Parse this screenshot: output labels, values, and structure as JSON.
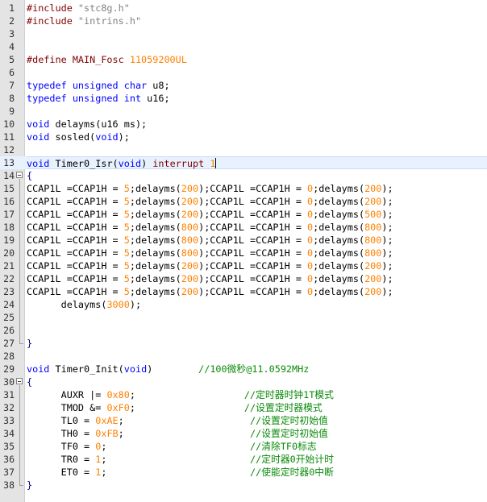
{
  "editor": {
    "current_line": 13,
    "lines": [
      {
        "n": "1",
        "toks": [
          [
            "pp",
            "#include "
          ],
          [
            "str",
            "\"stc8g.h\""
          ]
        ]
      },
      {
        "n": "2",
        "toks": [
          [
            "pp",
            "#include "
          ],
          [
            "str",
            "\"intrins.h\""
          ]
        ]
      },
      {
        "n": "3",
        "toks": []
      },
      {
        "n": "4",
        "toks": []
      },
      {
        "n": "5",
        "toks": [
          [
            "pp",
            "#define MAIN_Fosc "
          ],
          [
            "num",
            "11059200UL"
          ]
        ]
      },
      {
        "n": "6",
        "toks": []
      },
      {
        "n": "7",
        "toks": [
          [
            "kw",
            "typedef unsigned char"
          ],
          [
            "tx",
            " u8;"
          ]
        ]
      },
      {
        "n": "8",
        "toks": [
          [
            "kw",
            "typedef unsigned int"
          ],
          [
            "tx",
            " u16;"
          ]
        ]
      },
      {
        "n": "9",
        "toks": []
      },
      {
        "n": "10",
        "toks": [
          [
            "kw",
            "void"
          ],
          [
            "tx",
            " delayms(u16 ms);"
          ]
        ]
      },
      {
        "n": "11",
        "toks": [
          [
            "kw",
            "void"
          ],
          [
            "tx",
            " sosled("
          ],
          [
            "kw",
            "void"
          ],
          [
            "tx",
            ");"
          ]
        ]
      },
      {
        "n": "12",
        "toks": []
      },
      {
        "n": "13",
        "toks": [
          [
            "kw",
            "void"
          ],
          [
            "tx",
            " Timer0_Isr("
          ],
          [
            "kw",
            "void"
          ],
          [
            "tx",
            ") "
          ],
          [
            "pp",
            "interrupt"
          ],
          [
            "tx",
            " "
          ],
          [
            "num",
            "1"
          ]
        ]
      },
      {
        "n": "14",
        "toks": [
          [
            "op",
            "{"
          ]
        ],
        "fold": "start"
      },
      {
        "n": "15",
        "toks": [
          [
            "tx",
            "CCAP1L =CCAP1H = "
          ],
          [
            "num",
            "5"
          ],
          [
            "tx",
            ";delayms("
          ],
          [
            "num",
            "200"
          ],
          [
            "tx",
            ");CCAP1L =CCAP1H = "
          ],
          [
            "num",
            "0"
          ],
          [
            "tx",
            ";delayms("
          ],
          [
            "num",
            "200"
          ],
          [
            "tx",
            ");"
          ]
        ]
      },
      {
        "n": "16",
        "toks": [
          [
            "tx",
            "CCAP1L =CCAP1H = "
          ],
          [
            "num",
            "5"
          ],
          [
            "tx",
            ";delayms("
          ],
          [
            "num",
            "200"
          ],
          [
            "tx",
            ");CCAP1L =CCAP1H = "
          ],
          [
            "num",
            "0"
          ],
          [
            "tx",
            ";delayms("
          ],
          [
            "num",
            "200"
          ],
          [
            "tx",
            ");"
          ]
        ]
      },
      {
        "n": "17",
        "toks": [
          [
            "tx",
            "CCAP1L =CCAP1H = "
          ],
          [
            "num",
            "5"
          ],
          [
            "tx",
            ";delayms("
          ],
          [
            "num",
            "200"
          ],
          [
            "tx",
            ");CCAP1L =CCAP1H = "
          ],
          [
            "num",
            "0"
          ],
          [
            "tx",
            ";delayms("
          ],
          [
            "num",
            "500"
          ],
          [
            "tx",
            ");"
          ]
        ]
      },
      {
        "n": "18",
        "toks": [
          [
            "tx",
            "CCAP1L =CCAP1H = "
          ],
          [
            "num",
            "5"
          ],
          [
            "tx",
            ";delayms("
          ],
          [
            "num",
            "800"
          ],
          [
            "tx",
            ");CCAP1L =CCAP1H = "
          ],
          [
            "num",
            "0"
          ],
          [
            "tx",
            ";delayms("
          ],
          [
            "num",
            "800"
          ],
          [
            "tx",
            ");"
          ]
        ]
      },
      {
        "n": "19",
        "toks": [
          [
            "tx",
            "CCAP1L =CCAP1H = "
          ],
          [
            "num",
            "5"
          ],
          [
            "tx",
            ";delayms("
          ],
          [
            "num",
            "800"
          ],
          [
            "tx",
            ");CCAP1L =CCAP1H = "
          ],
          [
            "num",
            "0"
          ],
          [
            "tx",
            ";delayms("
          ],
          [
            "num",
            "800"
          ],
          [
            "tx",
            ");"
          ]
        ]
      },
      {
        "n": "20",
        "toks": [
          [
            "tx",
            "CCAP1L =CCAP1H = "
          ],
          [
            "num",
            "5"
          ],
          [
            "tx",
            ";delayms("
          ],
          [
            "num",
            "800"
          ],
          [
            "tx",
            ");CCAP1L =CCAP1H = "
          ],
          [
            "num",
            "0"
          ],
          [
            "tx",
            ";delayms("
          ],
          [
            "num",
            "800"
          ],
          [
            "tx",
            ");"
          ]
        ]
      },
      {
        "n": "21",
        "toks": [
          [
            "tx",
            "CCAP1L =CCAP1H = "
          ],
          [
            "num",
            "5"
          ],
          [
            "tx",
            ";delayms("
          ],
          [
            "num",
            "200"
          ],
          [
            "tx",
            ");CCAP1L =CCAP1H = "
          ],
          [
            "num",
            "0"
          ],
          [
            "tx",
            ";delayms("
          ],
          [
            "num",
            "200"
          ],
          [
            "tx",
            ");"
          ]
        ]
      },
      {
        "n": "22",
        "toks": [
          [
            "tx",
            "CCAP1L =CCAP1H = "
          ],
          [
            "num",
            "5"
          ],
          [
            "tx",
            ";delayms("
          ],
          [
            "num",
            "200"
          ],
          [
            "tx",
            ");CCAP1L =CCAP1H = "
          ],
          [
            "num",
            "0"
          ],
          [
            "tx",
            ";delayms("
          ],
          [
            "num",
            "200"
          ],
          [
            "tx",
            ");"
          ]
        ]
      },
      {
        "n": "23",
        "toks": [
          [
            "tx",
            "CCAP1L =CCAP1H = "
          ],
          [
            "num",
            "5"
          ],
          [
            "tx",
            ";delayms("
          ],
          [
            "num",
            "200"
          ],
          [
            "tx",
            ");CCAP1L =CCAP1H = "
          ],
          [
            "num",
            "0"
          ],
          [
            "tx",
            ";delayms("
          ],
          [
            "num",
            "200"
          ],
          [
            "tx",
            ");"
          ]
        ]
      },
      {
        "n": "24",
        "toks": [
          [
            "tx",
            "      delayms("
          ],
          [
            "num",
            "3000"
          ],
          [
            "tx",
            ");"
          ]
        ]
      },
      {
        "n": "25",
        "toks": []
      },
      {
        "n": "26",
        "toks": []
      },
      {
        "n": "27",
        "toks": [
          [
            "op",
            "}"
          ]
        ],
        "fold": "end"
      },
      {
        "n": "28",
        "toks": []
      },
      {
        "n": "29",
        "toks": [
          [
            "kw",
            "void"
          ],
          [
            "tx",
            " Timer0_Init("
          ],
          [
            "kw",
            "void"
          ],
          [
            "tx",
            ")        "
          ],
          [
            "cm",
            "//100微秒@11.0592MHz"
          ]
        ]
      },
      {
        "n": "30",
        "toks": [
          [
            "op",
            "{"
          ]
        ],
        "fold": "start"
      },
      {
        "n": "31",
        "toks": [
          [
            "tx",
            "      AUXR |= "
          ],
          [
            "num",
            "0x80"
          ],
          [
            "tx",
            ";                   "
          ],
          [
            "cm",
            "//定时器时钟1T模式"
          ]
        ]
      },
      {
        "n": "32",
        "toks": [
          [
            "tx",
            "      TMOD &= "
          ],
          [
            "num",
            "0xF0"
          ],
          [
            "tx",
            ";                   "
          ],
          [
            "cm",
            "//设置定时器模式"
          ]
        ]
      },
      {
        "n": "33",
        "toks": [
          [
            "tx",
            "      TL0 = "
          ],
          [
            "num",
            "0xAE"
          ],
          [
            "tx",
            ";                      "
          ],
          [
            "cm",
            "//设置定时初始值"
          ]
        ]
      },
      {
        "n": "34",
        "toks": [
          [
            "tx",
            "      TH0 = "
          ],
          [
            "num",
            "0xFB"
          ],
          [
            "tx",
            ";                      "
          ],
          [
            "cm",
            "//设置定时初始值"
          ]
        ]
      },
      {
        "n": "35",
        "toks": [
          [
            "tx",
            "      TF0 = "
          ],
          [
            "num",
            "0"
          ],
          [
            "tx",
            ";                         "
          ],
          [
            "cm",
            "//清除TF0标志"
          ]
        ]
      },
      {
        "n": "36",
        "toks": [
          [
            "tx",
            "      TR0 = "
          ],
          [
            "num",
            "1"
          ],
          [
            "tx",
            ";                         "
          ],
          [
            "cm",
            "//定时器0开始计时"
          ]
        ]
      },
      {
        "n": "37",
        "toks": [
          [
            "tx",
            "      ET0 = "
          ],
          [
            "num",
            "1"
          ],
          [
            "tx",
            ";                         "
          ],
          [
            "cm",
            "//使能定时器0中断"
          ]
        ]
      },
      {
        "n": "38",
        "toks": [
          [
            "op",
            "}"
          ]
        ],
        "fold": "end"
      }
    ]
  }
}
